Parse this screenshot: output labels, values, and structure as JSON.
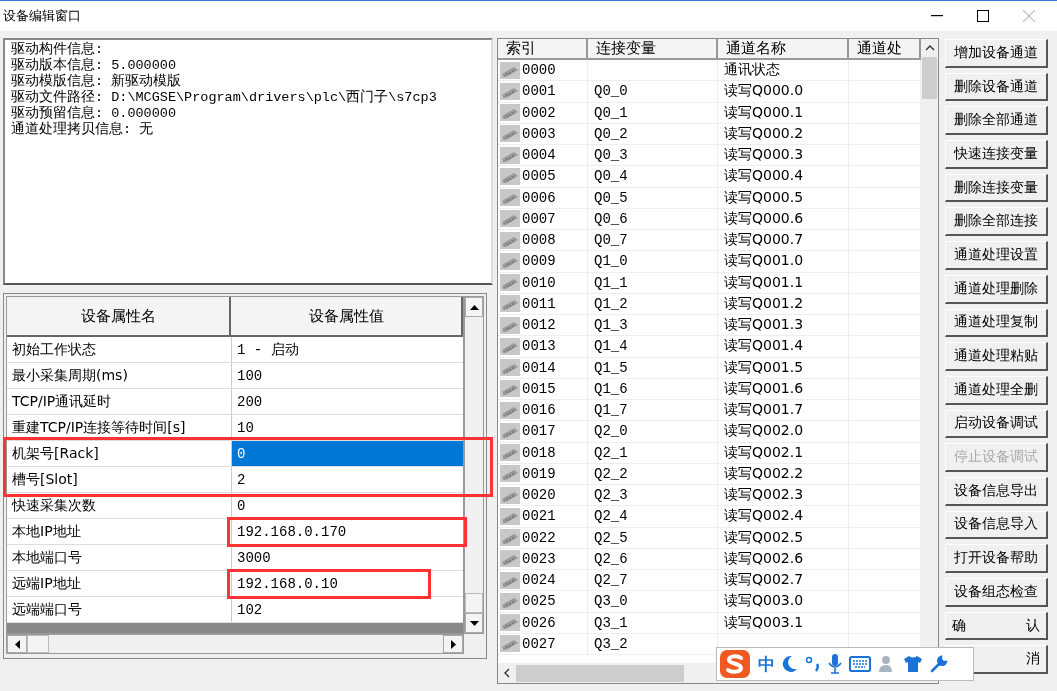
{
  "window": {
    "title": "设备编辑窗口"
  },
  "info_lines": [
    "驱动构件信息:",
    "驱动版本信息: 5.000000",
    "驱动模版信息: 新驱动模版",
    "驱动文件路径: D:\\MCGSE\\Program\\drivers\\plc\\西门子\\s7cp3",
    "驱动预留信息: 0.000000",
    "通道处理拷贝信息: 无"
  ],
  "props": {
    "columns": [
      "设备属性名",
      "设备属性值"
    ],
    "rows": [
      {
        "name": "初始工作状态",
        "value": "1 - 启动",
        "selected": false
      },
      {
        "name": "最小采集周期(ms)",
        "value": "100",
        "selected": false
      },
      {
        "name": "TCP/IP通讯延时",
        "value": "200",
        "selected": false
      },
      {
        "name": "重建TCP/IP连接等待时间[s]",
        "value": "10",
        "selected": false
      },
      {
        "name": "机架号[Rack]",
        "value": "0",
        "selected": true,
        "row_boxed": true
      },
      {
        "name": "槽号[Slot]",
        "value": "2",
        "selected": false,
        "row_boxed": true
      },
      {
        "name": "快速采集次数",
        "value": "0",
        "selected": false
      },
      {
        "name": "本地IP地址",
        "value": "192.168.0.170",
        "selected": false,
        "value_boxed": true
      },
      {
        "name": "本地端口号",
        "value": "3000",
        "selected": false
      },
      {
        "name": "远端IP地址",
        "value": "192.168.0.10",
        "selected": false,
        "value_boxed": true
      },
      {
        "name": "远端端口号",
        "value": "102",
        "selected": false
      }
    ]
  },
  "channels": {
    "columns": [
      "索引",
      "连接变量",
      "通道名称",
      "通道处"
    ],
    "rows": [
      [
        "0000",
        "",
        "通讯状态"
      ],
      [
        "0001",
        "Q0_0",
        "读写Q000.0"
      ],
      [
        "0002",
        "Q0_1",
        "读写Q000.1"
      ],
      [
        "0003",
        "Q0_2",
        "读写Q000.2"
      ],
      [
        "0004",
        "Q0_3",
        "读写Q000.3"
      ],
      [
        "0005",
        "Q0_4",
        "读写Q000.4"
      ],
      [
        "0006",
        "Q0_5",
        "读写Q000.5"
      ],
      [
        "0007",
        "Q0_6",
        "读写Q000.6"
      ],
      [
        "0008",
        "Q0_7",
        "读写Q000.7"
      ],
      [
        "0009",
        "Q1_0",
        "读写Q001.0"
      ],
      [
        "0010",
        "Q1_1",
        "读写Q001.1"
      ],
      [
        "0011",
        "Q1_2",
        "读写Q001.2"
      ],
      [
        "0012",
        "Q1_3",
        "读写Q001.3"
      ],
      [
        "0013",
        "Q1_4",
        "读写Q001.4"
      ],
      [
        "0014",
        "Q1_5",
        "读写Q001.5"
      ],
      [
        "0015",
        "Q1_6",
        "读写Q001.6"
      ],
      [
        "0016",
        "Q1_7",
        "读写Q001.7"
      ],
      [
        "0017",
        "Q2_0",
        "读写Q002.0"
      ],
      [
        "0018",
        "Q2_1",
        "读写Q002.1"
      ],
      [
        "0019",
        "Q2_2",
        "读写Q002.2"
      ],
      [
        "0020",
        "Q2_3",
        "读写Q002.3"
      ],
      [
        "0021",
        "Q2_4",
        "读写Q002.4"
      ],
      [
        "0022",
        "Q2_5",
        "读写Q002.5"
      ],
      [
        "0023",
        "Q2_6",
        "读写Q002.6"
      ],
      [
        "0024",
        "Q2_7",
        "读写Q002.7"
      ],
      [
        "0025",
        "Q3_0",
        "读写Q003.0"
      ],
      [
        "0026",
        "Q3_1",
        "读写Q003.1"
      ],
      [
        "0027",
        "Q3_2",
        ""
      ]
    ]
  },
  "buttons": [
    {
      "label": "增加设备通道",
      "disabled": false
    },
    {
      "label": "删除设备通道",
      "disabled": false
    },
    {
      "label": "删除全部通道",
      "disabled": false
    },
    {
      "label": "快速连接变量",
      "disabled": false
    },
    {
      "label": "删除连接变量",
      "disabled": false
    },
    {
      "label": "删除全部连接",
      "disabled": false
    },
    {
      "label": "通道处理设置",
      "disabled": false
    },
    {
      "label": "通道处理删除",
      "disabled": false
    },
    {
      "label": "通道处理复制",
      "disabled": false
    },
    {
      "label": "通道处理粘贴",
      "disabled": false
    },
    {
      "label": "通道处理全删",
      "disabled": false
    },
    {
      "label": "启动设备调试",
      "disabled": false
    },
    {
      "label": "停止设备调试",
      "disabled": true
    },
    {
      "label": "设备信息导出",
      "disabled": false
    },
    {
      "label": "设备信息导入",
      "disabled": false
    },
    {
      "label": "打开设备帮助",
      "disabled": false
    },
    {
      "label": "设备组态检查",
      "disabled": false
    },
    {
      "label": "确认",
      "disabled": false,
      "kind": "spread"
    },
    {
      "label": "消",
      "disabled": false,
      "kind": "right"
    }
  ],
  "ime_toolbar": {
    "mode": "中"
  }
}
